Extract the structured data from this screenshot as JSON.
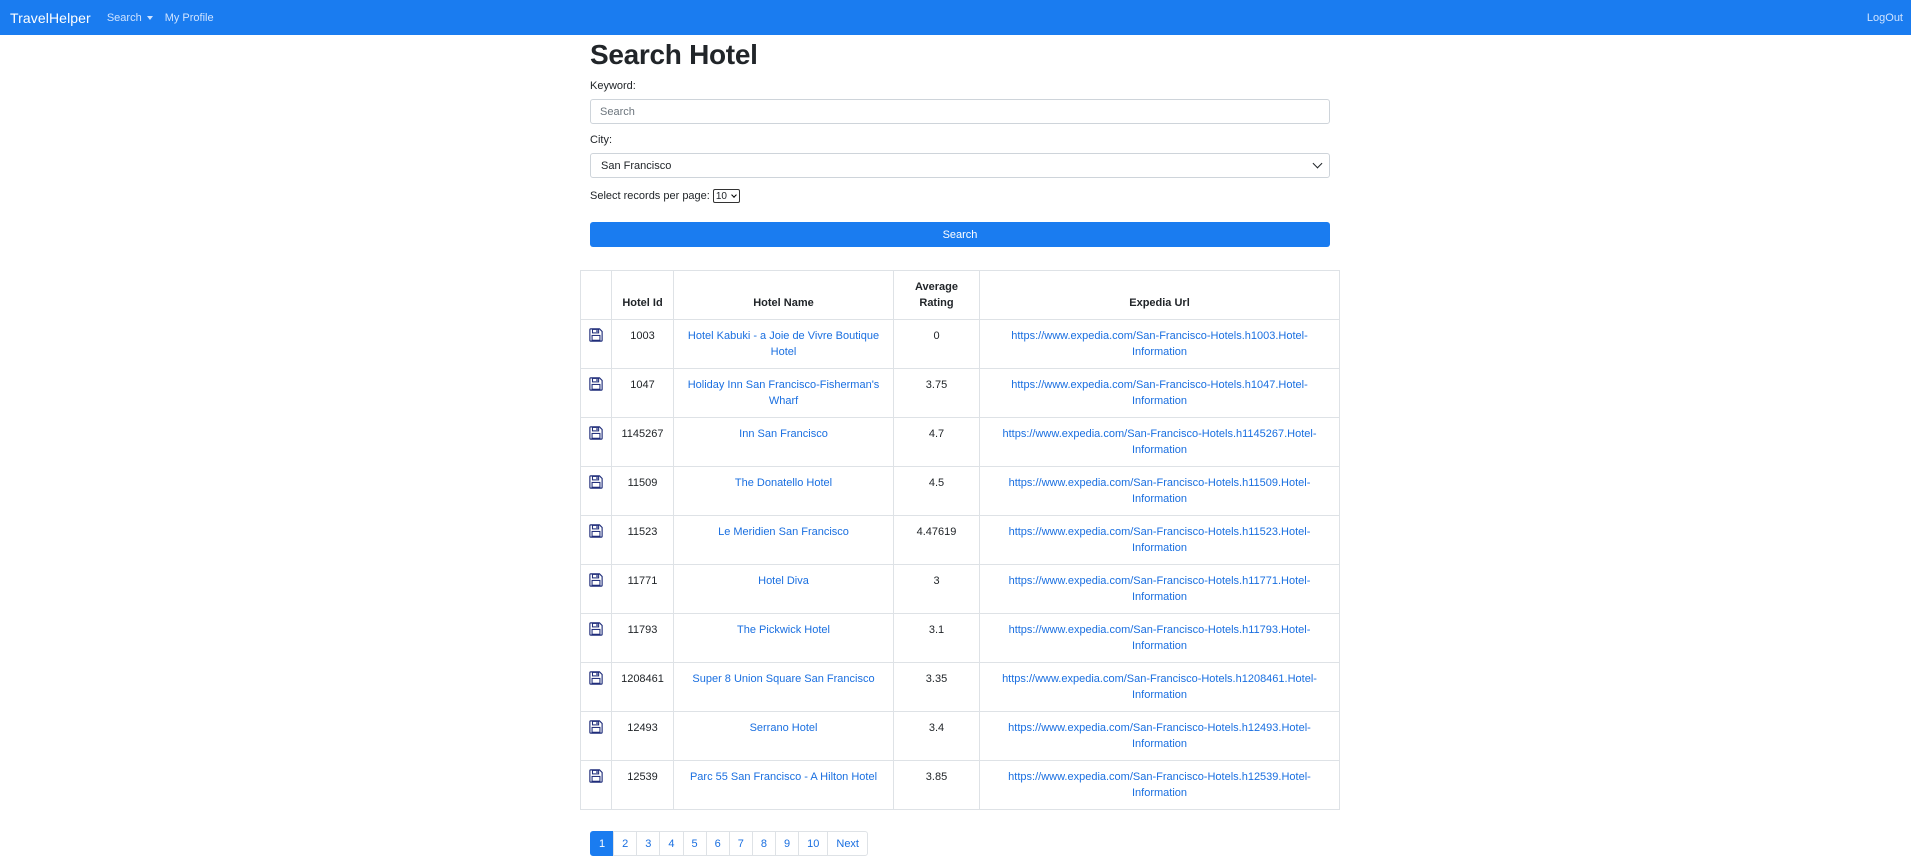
{
  "navbar": {
    "brand": "TravelHelper",
    "search_label": "Search",
    "profile_label": "My Profile",
    "logout_label": "LogOut"
  },
  "form": {
    "title": "Search Hotel",
    "keyword_label": "Keyword:",
    "keyword_placeholder": "Search",
    "keyword_value": "",
    "city_label": "City:",
    "city_selected": "San Francisco",
    "perpage_label": "Select records per page:",
    "perpage_selected": "10",
    "search_button": "Search"
  },
  "table": {
    "headers": [
      "",
      "Hotel Id",
      "Hotel Name",
      "Average Rating",
      "Expedia Url"
    ],
    "header_rating_line1": "Average",
    "header_rating_line2": "Rating",
    "rows": [
      {
        "id": "1003",
        "name": "Hotel Kabuki - a Joie de Vivre Boutique Hotel",
        "rating": "0",
        "url": "https://www.expedia.com/San-Francisco-Hotels.h1003.Hotel-Information"
      },
      {
        "id": "1047",
        "name": "Holiday Inn San Francisco-Fisherman's Wharf",
        "rating": "3.75",
        "url": "https://www.expedia.com/San-Francisco-Hotels.h1047.Hotel-Information"
      },
      {
        "id": "1145267",
        "name": "Inn San Francisco",
        "rating": "4.7",
        "url": "https://www.expedia.com/San-Francisco-Hotels.h1145267.Hotel-Information"
      },
      {
        "id": "11509",
        "name": "The Donatello Hotel",
        "rating": "4.5",
        "url": "https://www.expedia.com/San-Francisco-Hotels.h11509.Hotel-Information"
      },
      {
        "id": "11523",
        "name": "Le Meridien San Francisco",
        "rating": "4.47619",
        "url": "https://www.expedia.com/San-Francisco-Hotels.h11523.Hotel-Information"
      },
      {
        "id": "11771",
        "name": "Hotel Diva",
        "rating": "3",
        "url": "https://www.expedia.com/San-Francisco-Hotels.h11771.Hotel-Information"
      },
      {
        "id": "11793",
        "name": "The Pickwick Hotel",
        "rating": "3.1",
        "url": "https://www.expedia.com/San-Francisco-Hotels.h11793.Hotel-Information"
      },
      {
        "id": "1208461",
        "name": "Super 8 Union Square San Francisco",
        "rating": "3.35",
        "url": "https://www.expedia.com/San-Francisco-Hotels.h1208461.Hotel-Information"
      },
      {
        "id": "12493",
        "name": "Serrano Hotel",
        "rating": "3.4",
        "url": "https://www.expedia.com/San-Francisco-Hotels.h12493.Hotel-Information"
      },
      {
        "id": "12539",
        "name": "Parc 55 San Francisco - A Hilton Hotel",
        "rating": "3.85",
        "url": "https://www.expedia.com/San-Francisco-Hotels.h12539.Hotel-Information"
      }
    ],
    "row_icon": "save-icon"
  },
  "pagination": {
    "pages": [
      "1",
      "2",
      "3",
      "4",
      "5",
      "6",
      "7",
      "8",
      "9",
      "10"
    ],
    "active": "1",
    "next_label": "Next"
  },
  "colors": {
    "accent": "#1a7cf0",
    "link": "#1a6fe0",
    "save_icon": "#1f2d7a"
  }
}
